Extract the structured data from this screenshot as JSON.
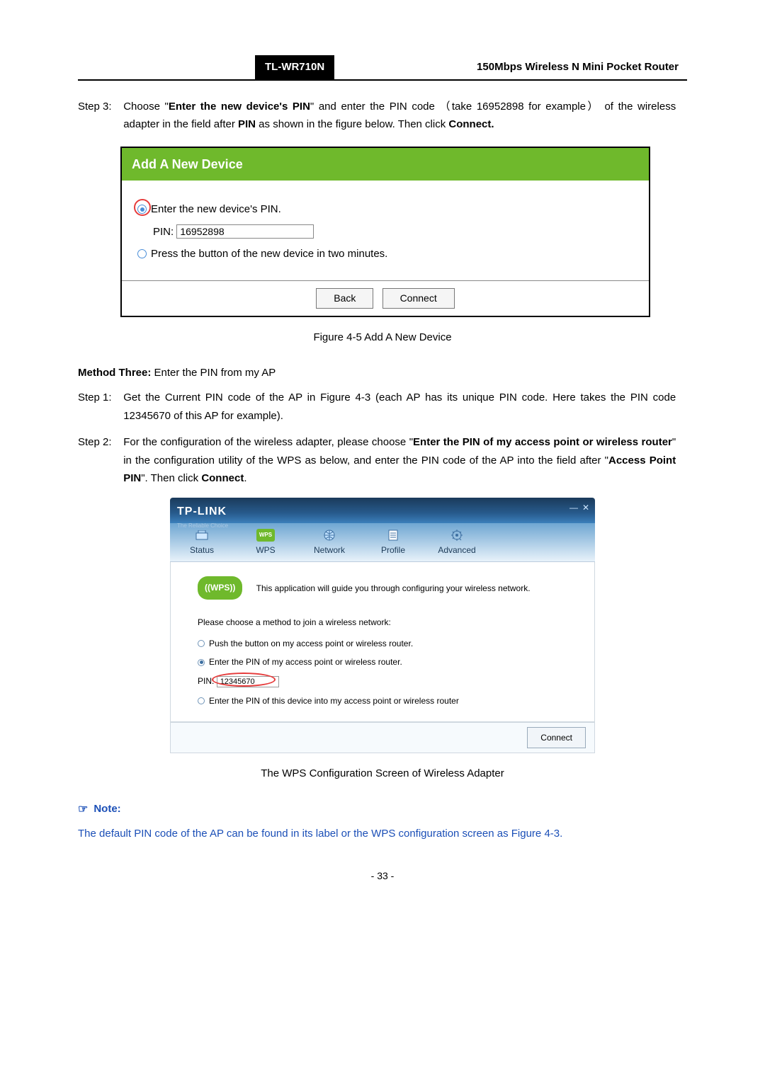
{
  "header": {
    "model": "TL-WR710N",
    "subtitle": "150Mbps Wireless N Mini Pocket Router"
  },
  "step3": {
    "label": "Step 3:",
    "t1": "Choose \"",
    "t2": "Enter the new device's PIN",
    "t3": "\" and enter the PIN code （take 16952898 for example） of the wireless adapter in the field after ",
    "t4": "PIN",
    "t5": " as shown in the figure below. Then click ",
    "t6": "Connect."
  },
  "figure1": {
    "title": "Add A New Device",
    "radio1": "Enter the new device's PIN.",
    "pin_label": "PIN:",
    "pin_value": "16952898",
    "radio2": "Press the button of the new device in two minutes.",
    "back_btn": "Back",
    "connect_btn": "Connect",
    "caption": "Figure 4-5 Add A New Device"
  },
  "method3": {
    "label": "Method Three:",
    "text": " Enter the PIN from my AP"
  },
  "m3step1": {
    "label": "Step 1:",
    "body": "Get the Current PIN code of the AP in Figure 4-3 (each AP has its unique PIN code. Here takes the PIN code 12345670 of this AP for example)."
  },
  "m3step2": {
    "label": "Step 2:",
    "t1": "For the configuration of the wireless adapter, please choose \"",
    "t2": "Enter the PIN of my access point or wireless router",
    "t3": "\" in the configuration utility of the WPS as below, and enter the PIN code of the AP into the field after \"",
    "t4": "Access Point PIN",
    "t5": "\". Then click ",
    "t6": "Connect",
    "t7": "."
  },
  "tplink": {
    "logo": "TP-LINK",
    "tagline": "The Reliable Choice",
    "tabs": {
      "status": "Status",
      "wps": "WPS",
      "network": "Network",
      "profile": "Profile",
      "advanced": "Advanced"
    },
    "guide": "This application will guide you through configuring your wireless network.",
    "wps_badge": "((WPS))",
    "prompt": "Please choose a method to join a wireless network:",
    "opt1": "Push the button on my access point or wireless router.",
    "opt2": "Enter the PIN of my access point or wireless router.",
    "pin_label": "PIN:",
    "pin_value": "12345670",
    "opt3": "Enter the PIN of this device into my access point or wireless router",
    "connect": "Connect",
    "caption": "The WPS Configuration Screen of Wireless Adapter"
  },
  "note": {
    "heading": "Note:",
    "body": "The default PIN code of the AP can be found in its label or the WPS configuration screen as Figure 4-3."
  },
  "pagenum": "- 33 -"
}
